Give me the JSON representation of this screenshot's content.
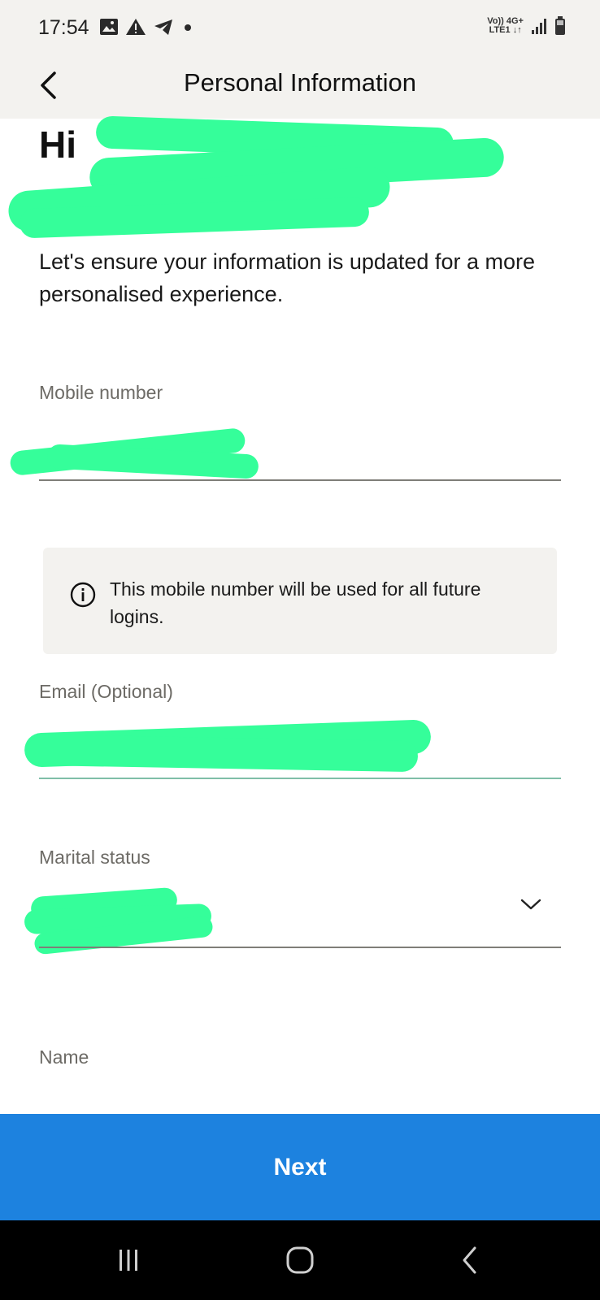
{
  "status_bar": {
    "time": "17:54",
    "left_icons": [
      "image-icon",
      "warning-icon",
      "telegram-icon",
      "dot-icon"
    ],
    "network_line1": "Vo)) 4G+",
    "network_line2": "LTE1 ↓↑",
    "right_icons": [
      "signal-icon",
      "battery-icon"
    ]
  },
  "app_bar": {
    "title": "Personal Information",
    "back_icon": "chevron-left-icon"
  },
  "greeting": {
    "prefix": "Hi"
  },
  "intro_text": "Let's ensure your information is updated for a more personalised experience.",
  "fields": {
    "mobile": {
      "label": "Mobile number"
    },
    "info_notice": "This mobile number will be used for all future logins.",
    "email": {
      "label": "Email (Optional)"
    },
    "marital": {
      "label": "Marital status",
      "dropdown_icon": "chevron-down-icon"
    },
    "name": {
      "label": "Name"
    }
  },
  "next_button": {
    "label": "Next"
  },
  "nav_bar": {
    "icons": [
      "recents-icon",
      "home-icon",
      "back-icon"
    ]
  },
  "colors": {
    "bar_background": "#f3f2ef",
    "primary_blue": "#1d82df",
    "redaction_green": "#35fe9a",
    "label_gray": "#6d6b66"
  }
}
